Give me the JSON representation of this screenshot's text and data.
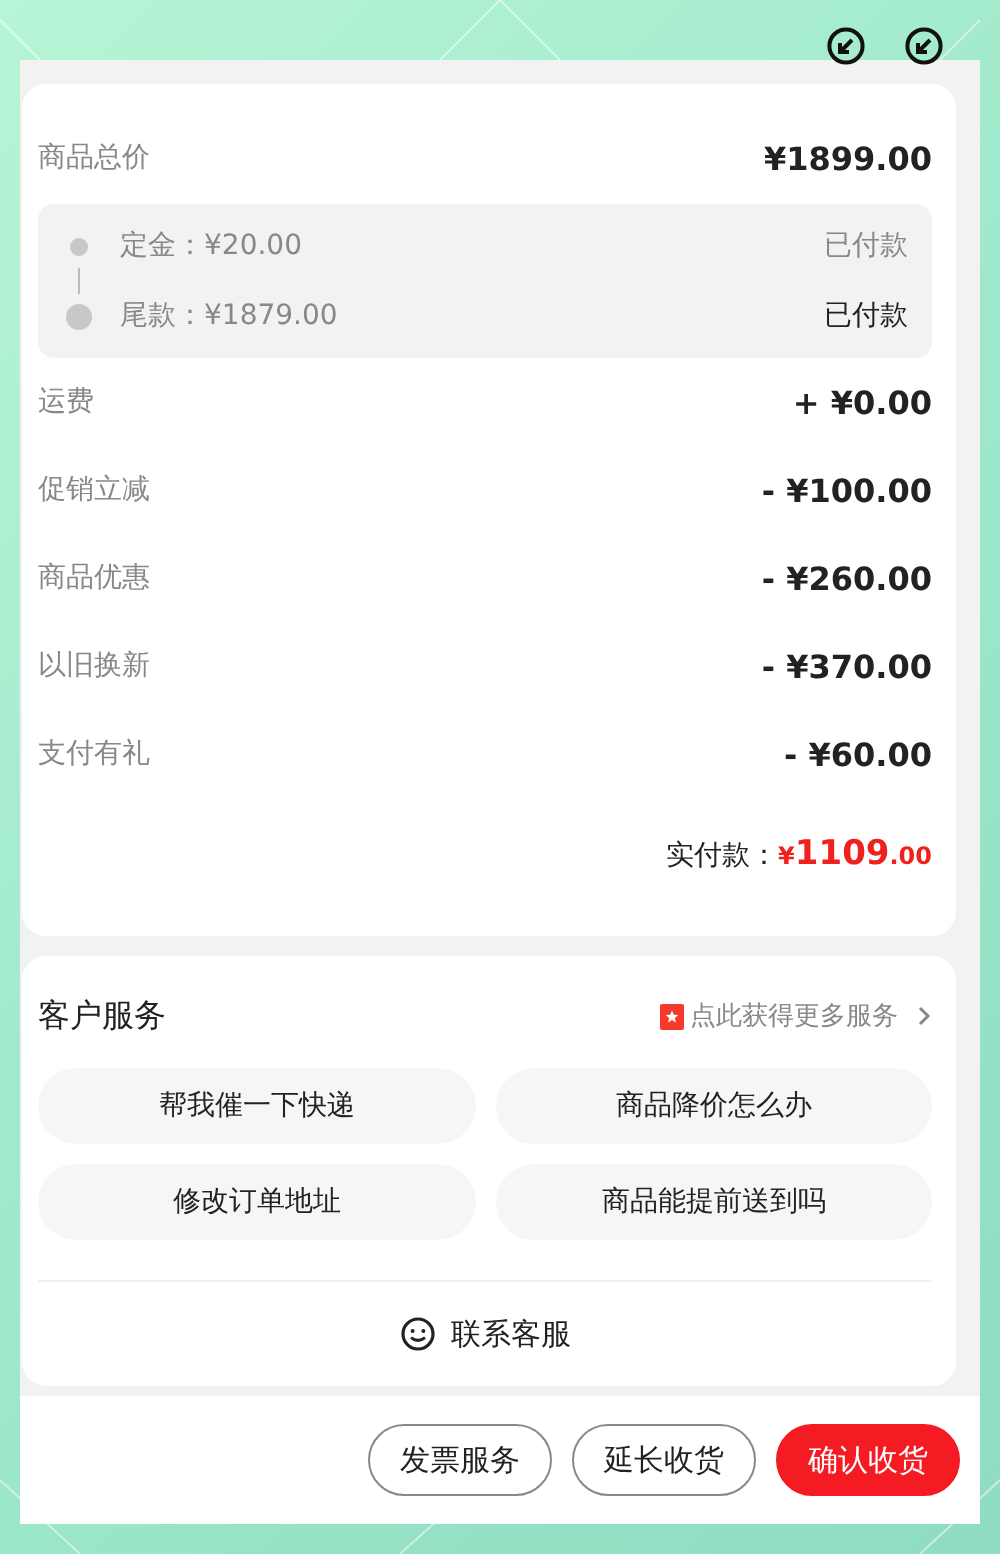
{
  "header_icons": [
    {
      "kind": "arrow-circle"
    },
    {
      "kind": "arrow-circle"
    }
  ],
  "price_summary": {
    "goods_total": {
      "label": "商品总价",
      "value": "¥1899.00"
    },
    "stages": [
      {
        "label": "定金：¥20.00",
        "status": "已付款",
        "current": false
      },
      {
        "label": "尾款：¥1879.00",
        "status": "已付款",
        "current": true
      }
    ],
    "adjustments": [
      {
        "label": "运费",
        "value": "+ ¥0.00"
      },
      {
        "label": "促销立减",
        "value": "- ¥100.00"
      },
      {
        "label": "商品优惠",
        "value": "- ¥260.00"
      },
      {
        "label": "以旧换新",
        "value": "- ¥370.00"
      },
      {
        "label": "支付有礼",
        "value": "- ¥60.00"
      }
    ],
    "paid": {
      "label": "实付款：",
      "amount": "¥1109.00"
    }
  },
  "customer_service": {
    "title": "客户服务",
    "more_link": "点此获得更多服务",
    "quick_questions": [
      "帮我催一下快递",
      "商品降价怎么办",
      "修改订单地址",
      "商品能提前送到吗"
    ],
    "contact": "联系客服"
  },
  "actions": [
    {
      "label": "发票服务",
      "primary": false
    },
    {
      "label": "延长收货",
      "primary": false
    },
    {
      "label": "确认收货",
      "primary": true
    }
  ]
}
